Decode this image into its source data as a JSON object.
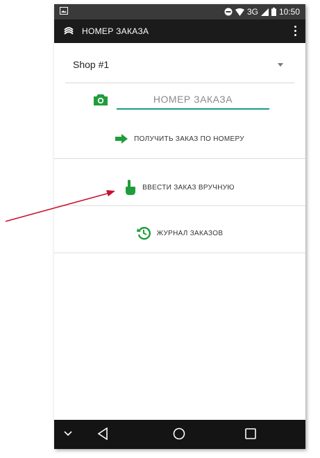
{
  "statusbar": {
    "network": "3G",
    "time": "10:50"
  },
  "appbar": {
    "title": "НОМЕР ЗАКАЗА"
  },
  "shop": {
    "selected": "Shop #1"
  },
  "order_input": {
    "placeholder": "НОМЕР ЗАКАЗА",
    "value": ""
  },
  "actions": {
    "get_by_number": "ПОЛУЧИТЬ ЗАКАЗ ПО НОМЕРУ",
    "manual_entry": "ВВЕСТИ ЗАКАЗ ВРУЧНУЮ",
    "order_log": "ЖУРНАЛ ЗАКАЗОВ"
  },
  "colors": {
    "accent_green": "#1f9d3a",
    "input_underline": "#1a9a8a",
    "annotation_arrow": "#c8102e"
  },
  "icons": [
    "camera-icon",
    "arrow-right-icon",
    "hand-pointer-icon",
    "history-icon"
  ]
}
